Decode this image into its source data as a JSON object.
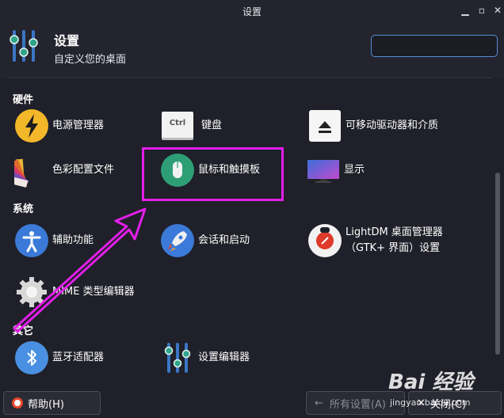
{
  "window": {
    "title": "设置",
    "minimize_icon": "minimize-icon",
    "maximize_icon": "maximize-icon",
    "close_icon": "close-icon"
  },
  "header": {
    "title": "设置",
    "subtitle": "自定义您的桌面",
    "search": {
      "value": "",
      "placeholder": ""
    }
  },
  "sections": {
    "hardware": "硬件",
    "system": "系统",
    "other": "其它"
  },
  "items": {
    "power": "电源管理器",
    "keyboard": "键盘",
    "keyboard_key": "Ctrl",
    "removable": "可移动驱动器和介质",
    "color": "色彩配置文件",
    "mouse": "鼠标和触摸板",
    "display": "显示",
    "accessibility": "辅助功能",
    "session": "会话和启动",
    "lightdm": "LightDM 桌面管理器（GTK+ 界面）设置",
    "mime": "MIME 类型编辑器",
    "bluetooth": "蓝牙适配器",
    "settings_editor": "设置编辑器"
  },
  "footer": {
    "help": "帮助(H)",
    "all_settings": "所有设置(A)",
    "close": "关闭(C)"
  },
  "annotation": {
    "color": "#e21ee8"
  },
  "watermark": {
    "brand": "Bai 经验",
    "url": "jingyan.baidu.com"
  }
}
